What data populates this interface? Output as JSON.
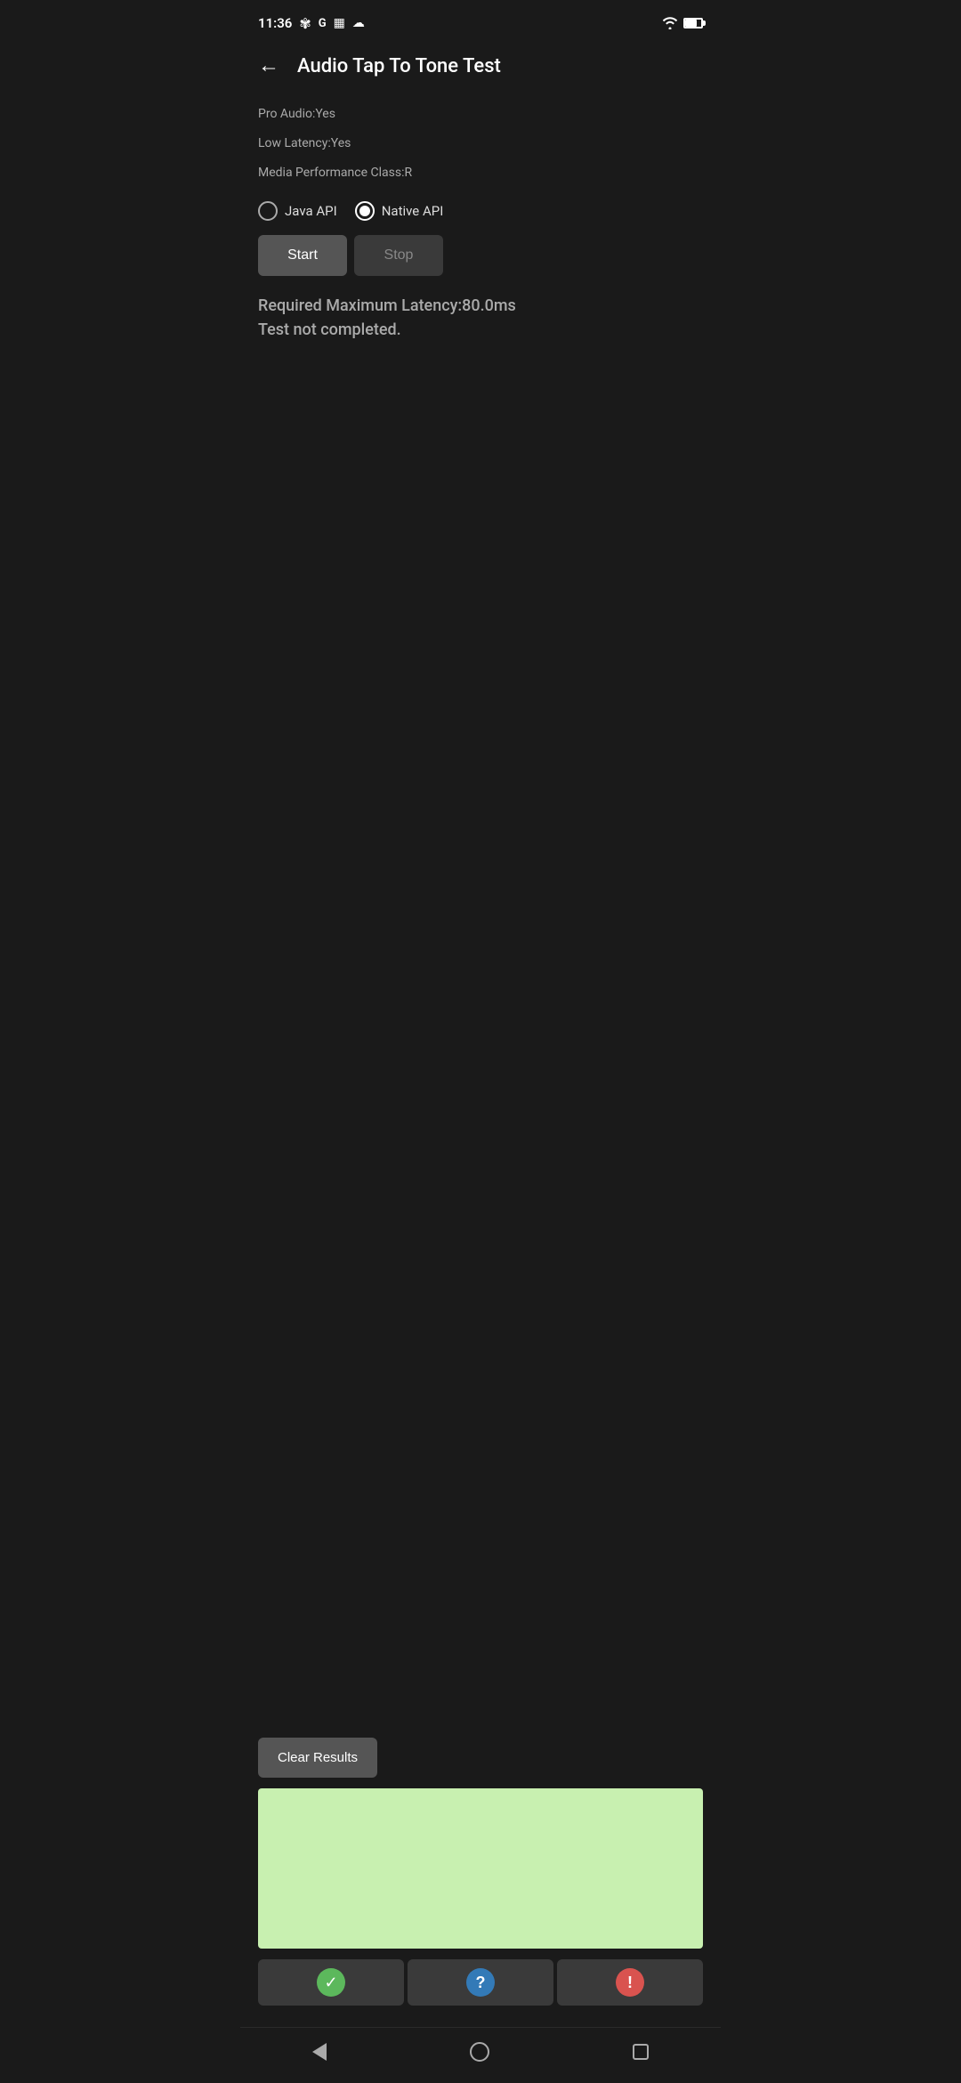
{
  "statusBar": {
    "time": "11:36",
    "icons": [
      "fan",
      "G",
      "calendar",
      "cloud"
    ]
  },
  "toolbar": {
    "back_label": "←",
    "title": "Audio Tap To Tone Test"
  },
  "info": {
    "pro_audio": "Pro Audio:Yes",
    "low_latency": "Low Latency:Yes",
    "media_perf": "Media Performance Class:R"
  },
  "radioGroup": {
    "option1": {
      "label": "Java API",
      "selected": false
    },
    "option2": {
      "label": "Native API",
      "selected": true
    }
  },
  "buttons": {
    "start": "Start",
    "stop": "Stop"
  },
  "statusMessage": {
    "line1": "Required Maximum Latency:80.0ms",
    "line2": "Test not completed."
  },
  "clearResults": "Clear Results",
  "bottomIcons": {
    "check": "✓",
    "question": "?",
    "warning": "!"
  },
  "navBar": {
    "back": "back",
    "home": "home",
    "recents": "recents"
  }
}
